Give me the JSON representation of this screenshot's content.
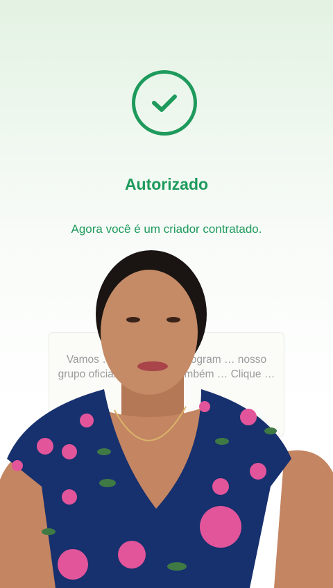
{
  "status": {
    "icon": "check-circle-icon",
    "title": "Autorizado",
    "subtitle": "Agora você é um criador contratado."
  },
  "info_card": {
    "text": "Vamos … ades sobre o program … nosso grupo oficial, o … grupo também … Clique …"
  },
  "colors": {
    "accent": "#1e9a5c",
    "card_text": "#9a9a9a"
  }
}
